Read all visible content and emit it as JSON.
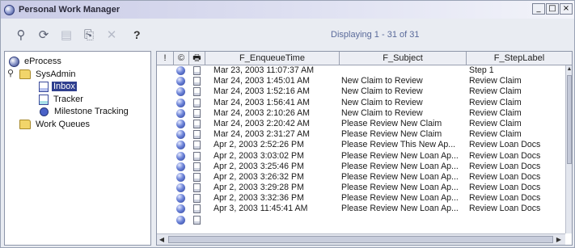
{
  "window": {
    "title": "Personal Work Manager",
    "controls": [
      "_",
      "□",
      "×"
    ]
  },
  "toolbar": {
    "help_label": "?",
    "status": "Displaying 1 - 31 of 31"
  },
  "tree": {
    "root": "eProcess",
    "toggle": "⚲",
    "sysadmin": "SysAdmin",
    "inbox": "Inbox",
    "tracker": "Tracker",
    "milestone": "Milestone Tracking",
    "work_queues": "Work Queues"
  },
  "grid": {
    "columns": [
      "!",
      "©",
      "🖶",
      "F_EnqueueTime",
      "F_Subject",
      "F_StepLabel"
    ],
    "rows": [
      {
        "time": "Mar 23, 2003 11:07:37 AM",
        "subject": "",
        "step": "Step 1"
      },
      {
        "time": "Mar 24, 2003 1:45:01 AM",
        "subject": "New Claim to Review",
        "step": "Review Claim"
      },
      {
        "time": "Mar 24, 2003 1:52:16 AM",
        "subject": "New Claim to Review",
        "step": "Review Claim"
      },
      {
        "time": "Mar 24, 2003 1:56:41 AM",
        "subject": "New Claim to Review",
        "step": "Review Claim"
      },
      {
        "time": "Mar 24, 2003 2:10:26 AM",
        "subject": "New Claim to Review",
        "step": "Review Claim"
      },
      {
        "time": "Mar 24, 2003 2:20:42 AM",
        "subject": "Please Review New Claim",
        "step": "Review Claim"
      },
      {
        "time": "Mar 24, 2003 2:31:27 AM",
        "subject": "Please Review New Claim",
        "step": "Review Claim"
      },
      {
        "time": "Apr 2, 2003 2:52:26 PM",
        "subject": "Please Review This New Ap...",
        "step": "Review Loan Docs"
      },
      {
        "time": "Apr 2, 2003 3:03:02 PM",
        "subject": "Please Review New Loan Ap...",
        "step": "Review Loan Docs"
      },
      {
        "time": "Apr 2, 2003 3:25:46 PM",
        "subject": "Please Review New Loan Ap...",
        "step": "Review Loan Docs"
      },
      {
        "time": "Apr 2, 2003 3:26:32 PM",
        "subject": "Please Review New Loan Ap...",
        "step": "Review Loan Docs"
      },
      {
        "time": "Apr 2, 2003 3:29:28 PM",
        "subject": "Please Review New Loan Ap...",
        "step": "Review Loan Docs"
      },
      {
        "time": "Apr 2, 2003 3:32:36 PM",
        "subject": "Please Review New Loan Ap...",
        "step": "Review Loan Docs"
      },
      {
        "time": "Apr 3, 2003 11:45:41 AM",
        "subject": "Please Review New Loan Ap...",
        "step": "Review Loan Docs"
      },
      {
        "time": "",
        "subject": "",
        "step": ""
      }
    ]
  },
  "scrollbars": {
    "up": "▲",
    "left": "◀",
    "right": "▶"
  }
}
